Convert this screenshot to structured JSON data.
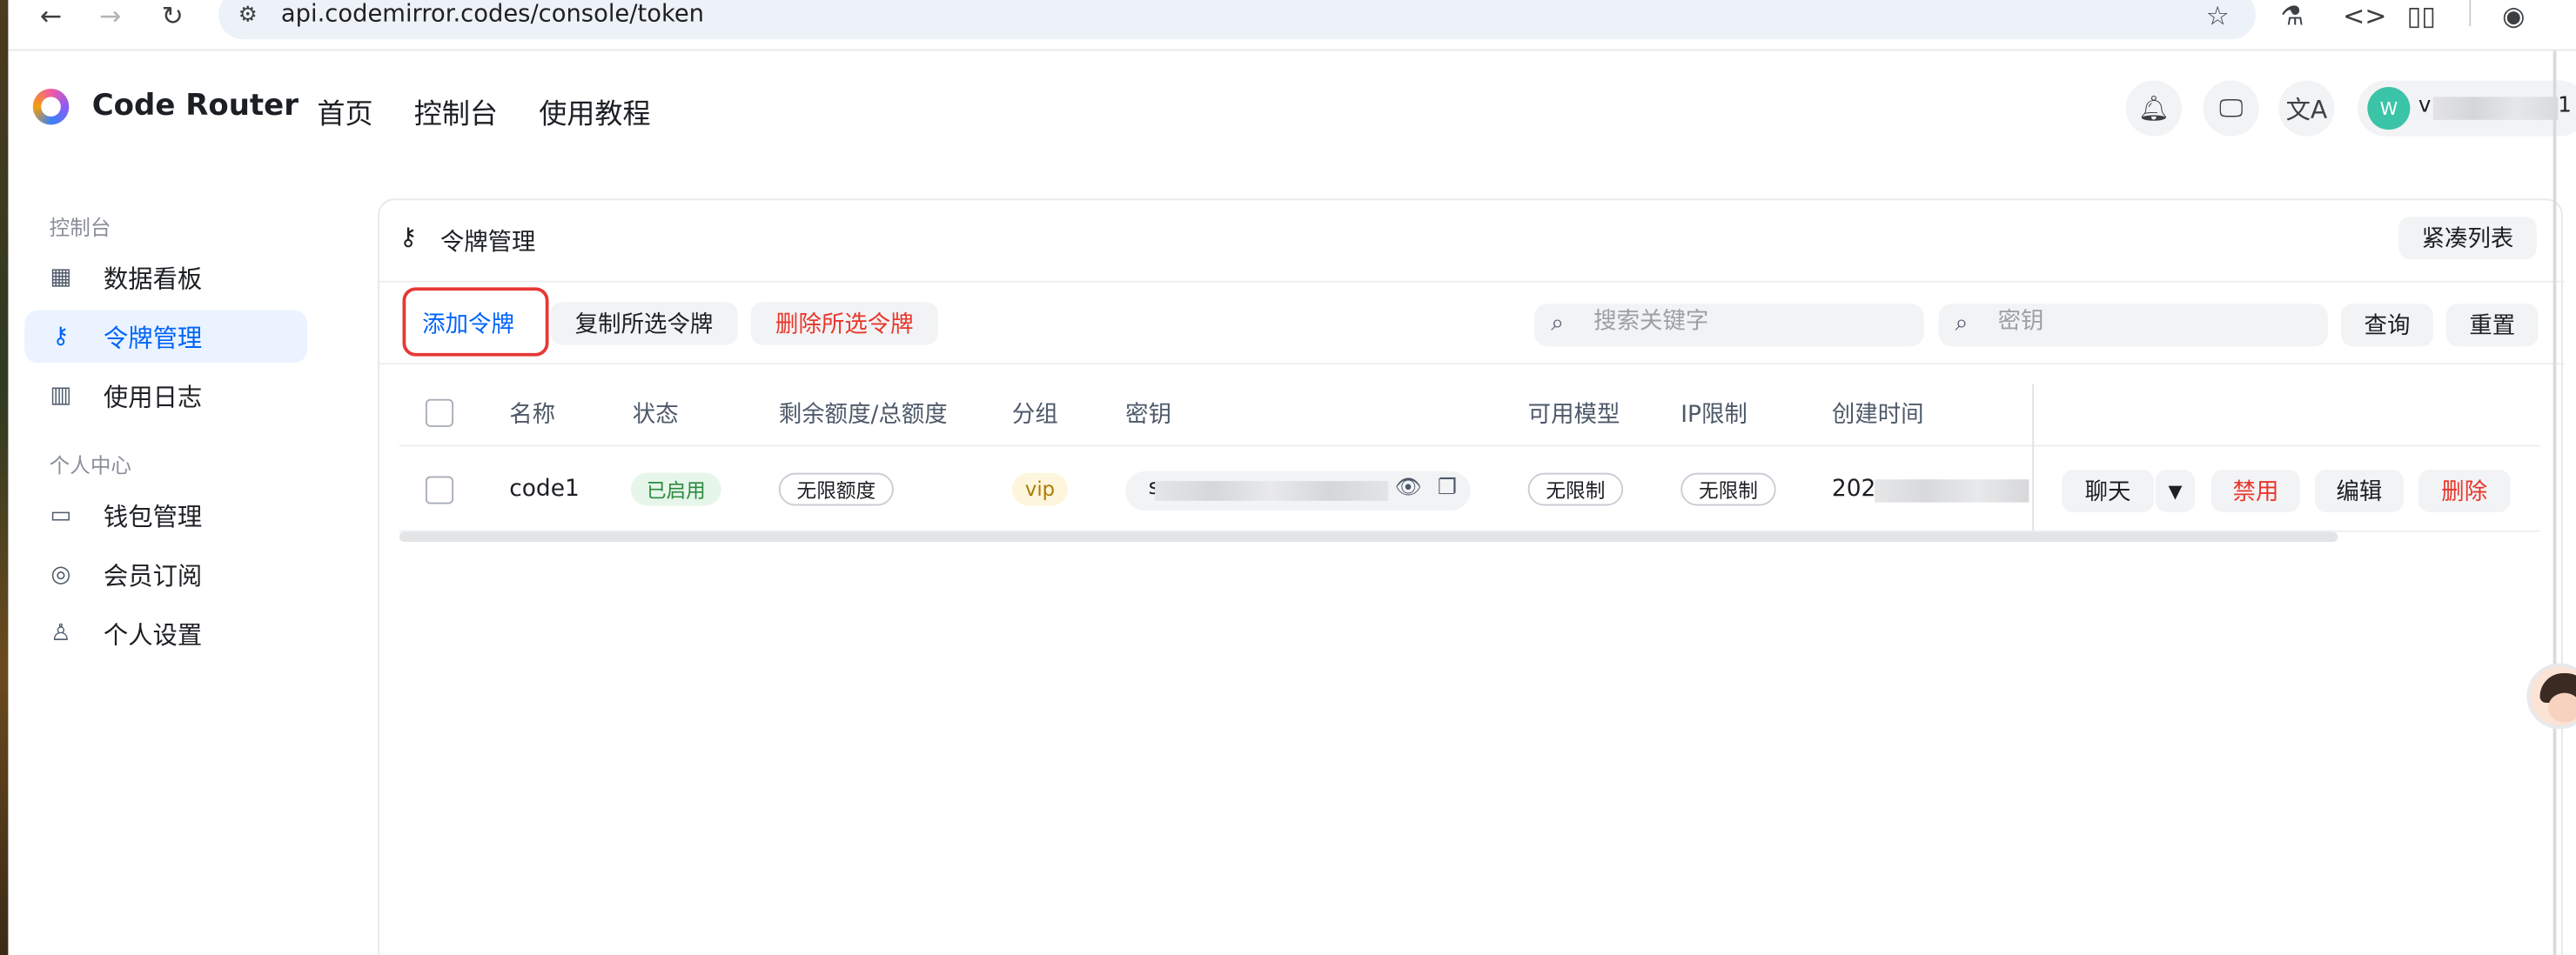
{
  "browser": {
    "url": "api.codemirror.codes/console/token",
    "back_icon": "arrow-left-icon",
    "forward_icon": "arrow-right-icon",
    "reload_icon": "reload-icon"
  },
  "header": {
    "brand": "Code Router",
    "nav": [
      "首页",
      "控制台",
      "使用教程"
    ],
    "user_initial": "W",
    "user_name_start": "v",
    "user_name_end": "1"
  },
  "sidebar": {
    "group1": "控制台",
    "group2": "个人中心",
    "items": [
      {
        "label": "数据看板",
        "icon": "dashboard-icon"
      },
      {
        "label": "令牌管理",
        "icon": "key-icon",
        "active": true
      },
      {
        "label": "使用日志",
        "icon": "bar-chart-icon"
      },
      {
        "label": "钱包管理",
        "icon": "wallet-icon"
      },
      {
        "label": "会员订阅",
        "icon": "subscription-icon"
      },
      {
        "label": "个人设置",
        "icon": "user-icon"
      }
    ]
  },
  "card": {
    "title": "令牌管理",
    "compact_list": "紧凑列表",
    "add_token": "添加令牌",
    "copy_selected": "复制所选令牌",
    "delete_selected": "删除所选令牌",
    "search_keyword_placeholder": "搜索关键字",
    "search_key_placeholder": "密钥",
    "query": "查询",
    "reset": "重置"
  },
  "table": {
    "columns": [
      "名称",
      "状态",
      "剩余额度/总额度",
      "分组",
      "密钥",
      "可用模型",
      "IP限制",
      "创建时间"
    ],
    "rows": [
      {
        "name": "code1",
        "status": "已启用",
        "quota": "无限额度",
        "group": "vip",
        "key_start": "s",
        "models": "无限制",
        "ip_limit": "无限制",
        "created_start": "202",
        "actions": {
          "chat": "聊天",
          "disable": "禁用",
          "edit": "编辑",
          "delete": "删除"
        }
      }
    ]
  },
  "colors": {
    "accent": "#0064fa",
    "danger": "#e8362b",
    "success": "#2b8a3e"
  }
}
